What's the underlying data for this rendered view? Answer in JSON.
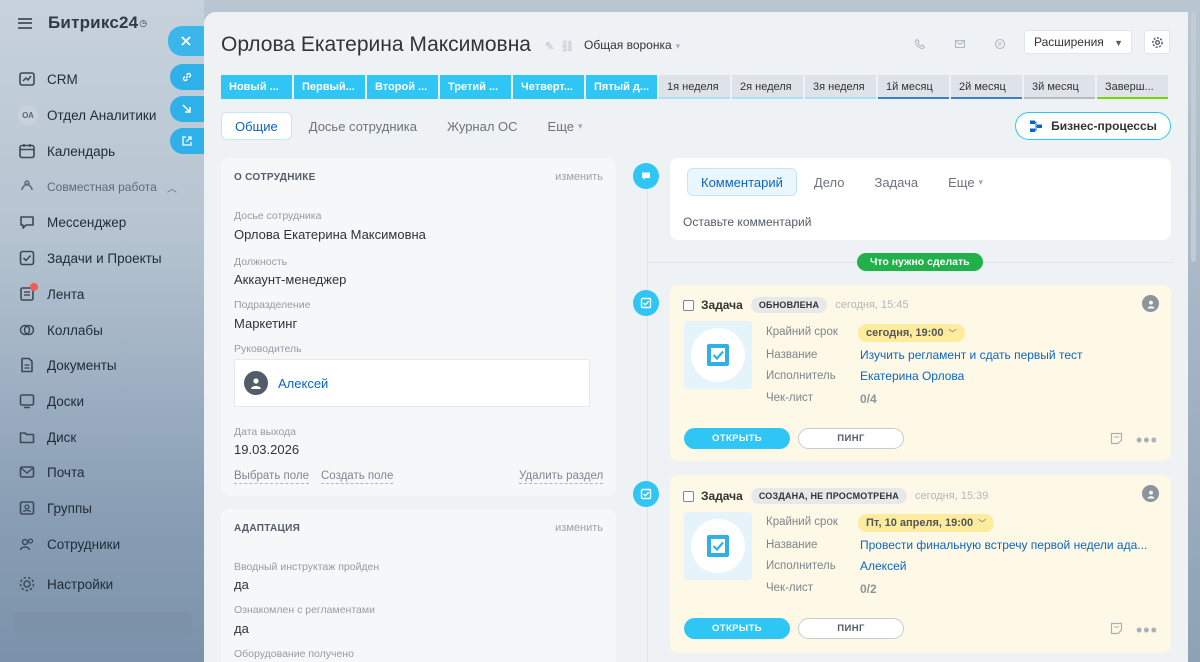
{
  "app": {
    "brand": "Битрикс24",
    "brand_mark": "◷"
  },
  "sidebar": {
    "items": [
      {
        "label": "CRM",
        "icon": "crm-icon"
      },
      {
        "label": "Отдел Аналитики",
        "avatar": "ОА"
      },
      {
        "label": "Календарь",
        "icon": "calendar-icon"
      },
      {
        "label": "Совместная работа",
        "section": true
      },
      {
        "label": "Мессенджер",
        "icon": "messenger-icon"
      },
      {
        "label": "Задачи и Проекты",
        "icon": "tasks-icon"
      },
      {
        "label": "Лента",
        "icon": "feed-icon"
      },
      {
        "label": "Коллабы",
        "icon": "collabs-icon"
      },
      {
        "label": "Документы",
        "icon": "documents-icon"
      },
      {
        "label": "Доски",
        "icon": "boards-icon"
      },
      {
        "label": "Диск",
        "icon": "disk-icon"
      },
      {
        "label": "Почта",
        "icon": "mail-icon"
      },
      {
        "label": "Группы",
        "icon": "groups-icon"
      },
      {
        "label": "Сотрудники",
        "icon": "employees-icon"
      },
      {
        "label": "Настройки",
        "icon": "settings-icon"
      }
    ]
  },
  "header": {
    "title": "Орлова Екатерина Максимовна",
    "funnel": "Общая воронка",
    "extensions_label": "Расширения"
  },
  "stages": [
    {
      "label": "Новый ...",
      "state": "active"
    },
    {
      "label": "Первый...",
      "state": "active"
    },
    {
      "label": "Второй ...",
      "state": "active"
    },
    {
      "label": "Третий ...",
      "state": "active"
    },
    {
      "label": "Четверт...",
      "state": "active"
    },
    {
      "label": "Пятый д...",
      "state": "active"
    },
    {
      "label": "1я неделя",
      "state": "inactive",
      "bar_color": "#a8e0f5"
    },
    {
      "label": "2я неделя",
      "state": "inactive",
      "bar_color": "#a8e0f5"
    },
    {
      "label": "3я неделя",
      "state": "inactive",
      "bar_color": "#a8e0f5"
    },
    {
      "label": "1й месяц",
      "state": "inactive",
      "bar_color": "#3c7fd0"
    },
    {
      "label": "2й месяц",
      "state": "inactive",
      "bar_color": "#3c7fd0"
    },
    {
      "label": "3й месяц",
      "state": "inactive",
      "bar_color": "#b4bcc4"
    },
    {
      "label": "Заверш...",
      "state": "inactive",
      "bar_color": "#7bd500"
    }
  ],
  "tabs": [
    {
      "label": "Общие",
      "active": true
    },
    {
      "label": "Досье сотрудника"
    },
    {
      "label": "Журнал ОС"
    },
    {
      "label": "Еще",
      "dropdown": true
    }
  ],
  "bp_button": "Бизнес-процессы",
  "about": {
    "title": "О СОТРУДНИКЕ",
    "edit": "изменить",
    "fields": [
      {
        "label": "Досье сотрудника",
        "value": "Орлова Екатерина Максимовна"
      },
      {
        "label": "Должность",
        "value": "Аккаунт-менеджер"
      },
      {
        "label": "Подразделение",
        "value": "Маркетинг"
      }
    ],
    "manager_label": "Руководитель",
    "manager_name": "Алексей",
    "exit_label": "Дата выхода",
    "exit_value": "19.03.2026",
    "link_select": "Выбрать поле",
    "link_create": "Создать поле",
    "link_delete": "Удалить раздел"
  },
  "adaptation": {
    "title": "АДАПТАЦИЯ",
    "edit": "изменить",
    "fields": [
      {
        "label": "Вводный инструктаж пройден",
        "value": "да"
      },
      {
        "label": "Ознакомлен с регламентами",
        "value": "да"
      },
      {
        "label": "Оборудование получено",
        "value": ""
      }
    ]
  },
  "comment": {
    "tabs": [
      {
        "label": "Комментарий",
        "active": true
      },
      {
        "label": "Дело"
      },
      {
        "label": "Задача"
      },
      {
        "label": "Еще",
        "dropdown": true
      }
    ],
    "placeholder": "Оставьте комментарий"
  },
  "todo_label": "Что нужно сделать",
  "tasks": [
    {
      "type": "Задача",
      "status": "ОБНОВЛЕНА",
      "time": "сегодня, 15:45",
      "deadline_label": "Крайний срок",
      "deadline": "сегодня, 19:00",
      "name_label": "Название",
      "name": "Изучить регламент и сдать первый тест",
      "assignee_label": "Исполнитель",
      "assignee": "Екатерина Орлова",
      "checklist_label": "Чек-лист",
      "checklist": "0/4",
      "open": "ОТКРЫТЬ",
      "ping": "ПИНГ"
    },
    {
      "type": "Задача",
      "status": "СОЗДАНА, НЕ ПРОСМОТРЕНА",
      "time": "сегодня, 15:39",
      "deadline_label": "Крайний срок",
      "deadline": "Пт, 10 апреля, 19:00",
      "name_label": "Название",
      "name": "Провести финальную встречу первой недели ада...",
      "assignee_label": "Исполнитель",
      "assignee": "Алексей",
      "checklist_label": "Чек-лист",
      "checklist": "0/2",
      "open": "ОТКРЫТЬ",
      "ping": "ПИНГ"
    }
  ],
  "more_glyph": "•••",
  "colors": {
    "accent": "#2fc6f6",
    "link": "#0b66c3",
    "todo": "#21b04a"
  }
}
